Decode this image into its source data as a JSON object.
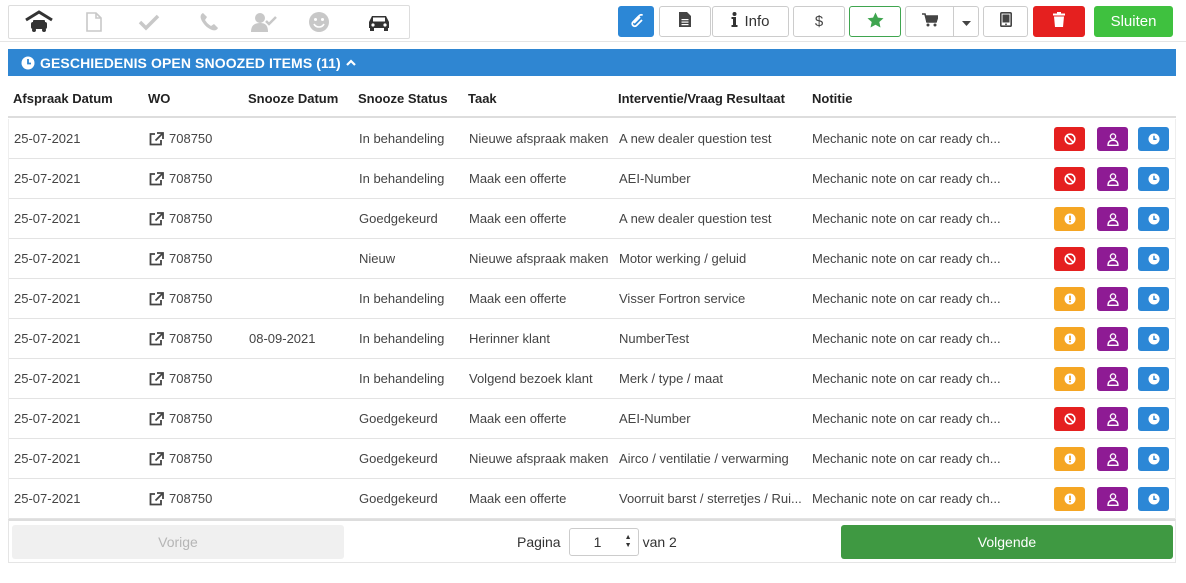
{
  "toolbar": {
    "info_label": "Info",
    "close_label": "Sluiten"
  },
  "panel": {
    "title": "GESCHIEDENIS OPEN SNOOZED ITEMS (11)"
  },
  "table": {
    "headers": [
      "Afspraak Datum",
      "WO",
      "Snooze Datum",
      "Snooze Status",
      "Taak",
      "Interventie/Vraag Resultaat",
      "Notitie"
    ],
    "rows": [
      {
        "date": "25-07-2021",
        "wo": "708750",
        "snooze": "",
        "status": "In behandeling",
        "task": "Nieuwe afspraak maken",
        "result": "A new dealer question test",
        "note": "Mechanic note on car ready ch...",
        "first_action": "red"
      },
      {
        "date": "25-07-2021",
        "wo": "708750",
        "snooze": "",
        "status": "In behandeling",
        "task": "Maak een offerte",
        "result": "AEI-Number",
        "note": "Mechanic note on car ready ch...",
        "first_action": "red"
      },
      {
        "date": "25-07-2021",
        "wo": "708750",
        "snooze": "",
        "status": "Goedgekeurd",
        "task": "Maak een offerte",
        "result": "A new dealer question test",
        "note": "Mechanic note on car ready ch...",
        "first_action": "orange"
      },
      {
        "date": "25-07-2021",
        "wo": "708750",
        "snooze": "",
        "status": "Nieuw",
        "task": "Nieuwe afspraak maken",
        "result": "Motor werking / geluid",
        "note": "Mechanic note on car ready ch...",
        "first_action": "red"
      },
      {
        "date": "25-07-2021",
        "wo": "708750",
        "snooze": "",
        "status": "In behandeling",
        "task": "Maak een offerte",
        "result": "Visser Fortron service",
        "note": "Mechanic note on car ready ch...",
        "first_action": "orange"
      },
      {
        "date": "25-07-2021",
        "wo": "708750",
        "snooze": "08-09-2021",
        "status": "In behandeling",
        "task": "Herinner klant",
        "result": "NumberTest",
        "note": "Mechanic note on car ready ch...",
        "first_action": "orange"
      },
      {
        "date": "25-07-2021",
        "wo": "708750",
        "snooze": "",
        "status": "In behandeling",
        "task": "Volgend bezoek klant",
        "result": "Merk / type / maat",
        "note": "Mechanic note on car ready ch...",
        "first_action": "orange"
      },
      {
        "date": "25-07-2021",
        "wo": "708750",
        "snooze": "",
        "status": "Goedgekeurd",
        "task": "Maak een offerte",
        "result": "AEI-Number",
        "note": "Mechanic note on car ready ch...",
        "first_action": "red"
      },
      {
        "date": "25-07-2021",
        "wo": "708750",
        "snooze": "",
        "status": "Goedgekeurd",
        "task": "Nieuwe afspraak maken",
        "result": "Airco / ventilatie / verwarming",
        "note": "Mechanic note on car ready ch...",
        "first_action": "orange"
      },
      {
        "date": "25-07-2021",
        "wo": "708750",
        "snooze": "",
        "status": "Goedgekeurd",
        "task": "Maak een offerte",
        "result": "Voorruit barst / sterretjes / Rui...",
        "note": "Mechanic note on car ready ch...",
        "first_action": "orange"
      }
    ]
  },
  "pagination": {
    "prev_label": "Vorige",
    "page_label": "Pagina",
    "page_value": "1",
    "of_label": "van 2",
    "next_label": "Volgende"
  },
  "colors": {
    "primary": "#2f86d2",
    "danger": "#e5201f",
    "warning": "#f5a623",
    "purple": "#8e1b94",
    "success": "#3f9942"
  }
}
